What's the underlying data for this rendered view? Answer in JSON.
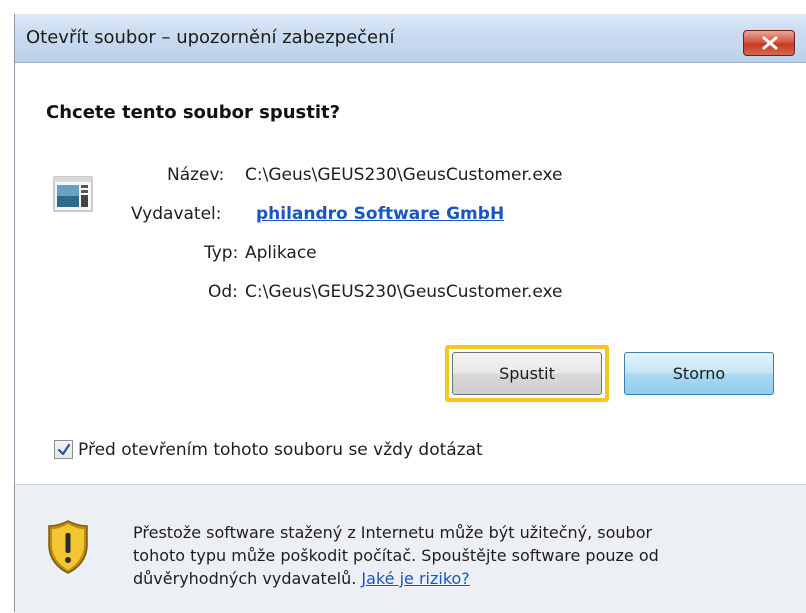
{
  "window": {
    "title": "Otevřít soubor – upozornění zabezpečení",
    "close_icon": "close-icon"
  },
  "dialog": {
    "heading": "Chcete tento soubor spustit?",
    "fields": {
      "name_label": "Název:",
      "name_value": "C:\\Geus\\GEUS230\\GeusCustomer.exe",
      "publisher_label": "Vydavatel:",
      "publisher_value": "philandro Software GmbH",
      "type_label": "Typ:",
      "type_value": "Aplikace",
      "from_label": "Od:",
      "from_value": "C:\\Geus\\GEUS230\\GeusCustomer.exe"
    },
    "buttons": {
      "run_label": "Spustit",
      "cancel_label": "Storno"
    },
    "checkbox": {
      "checked": true,
      "label": "Před otevřením tohoto souboru se vždy dotázat"
    },
    "warning": {
      "line1": "Přestože software stažený z Internetu může být užitečný, soubor",
      "line2": "tohoto typu může poškodit počítač. Spouštějte software pouze od",
      "line3_text": "důvěryhodných vydavatelů. ",
      "risk_link": "Jaké je riziko?"
    }
  },
  "colors": {
    "link": "#1a55c4",
    "focus_ring": "#f5c524",
    "titlebar": "#c9dbf0",
    "warning_pane": "#ecf0f5"
  }
}
